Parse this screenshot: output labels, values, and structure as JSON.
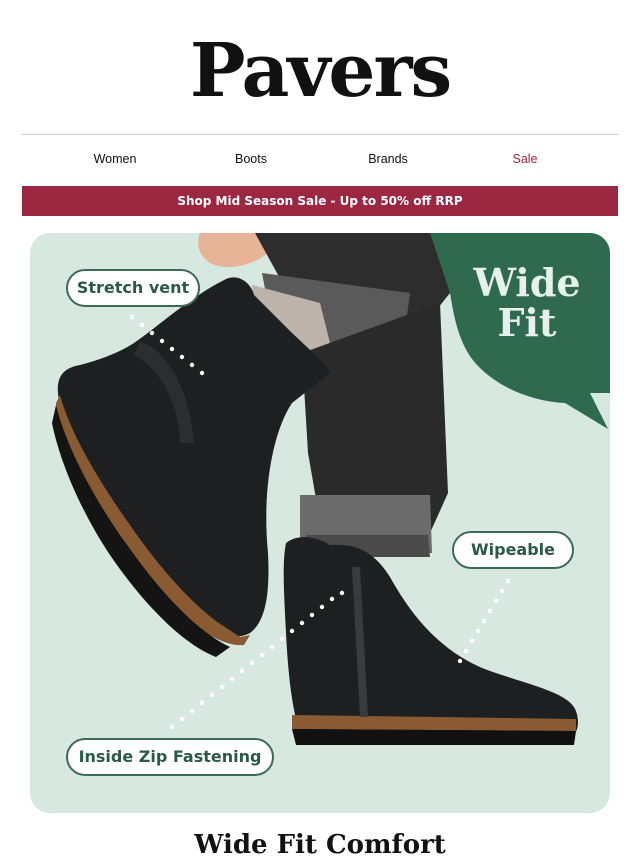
{
  "brand": {
    "logo": "Pavers"
  },
  "nav": {
    "items": [
      {
        "label": "Women"
      },
      {
        "label": "Boots"
      },
      {
        "label": "Brands"
      },
      {
        "label": "Sale"
      }
    ],
    "sale_color": "#9c2740"
  },
  "banner": {
    "text": "Shop Mid Season Sale - Up to 50% off RRP",
    "color": "#9c2740"
  },
  "hero": {
    "badge_line1": "Wide",
    "badge_line2": "Fit",
    "callouts": {
      "stretch_vent": "Stretch vent",
      "wipeable": "Wipeable",
      "inside_zip": "Inside Zip Fastening"
    },
    "background_color": "#d7e8e0",
    "badge_color": "#2f6a4f"
  },
  "section": {
    "headline": "Wide Fit Comfort"
  }
}
